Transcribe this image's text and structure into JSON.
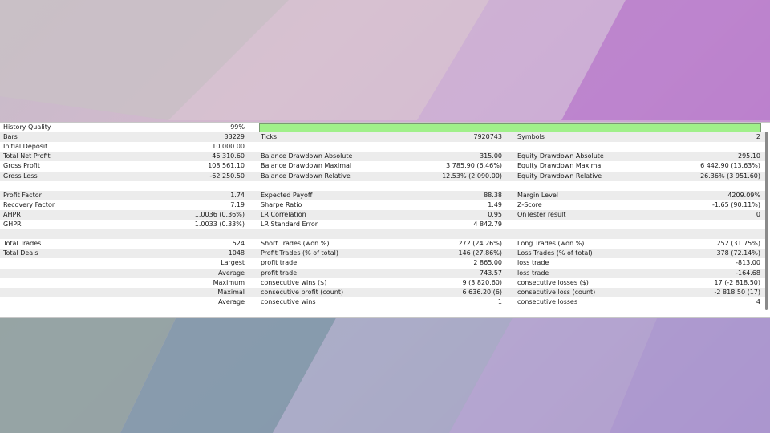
{
  "colors": {
    "quality_bar": "#a0f08a",
    "row_alt": "#ececec"
  },
  "rows": [
    {
      "c1": "History Quality",
      "v1": "99%",
      "quality_pct": 99
    },
    {
      "c1": "Bars",
      "v1": "33229",
      "c2": "Ticks",
      "v2": "7920743",
      "c3": "Symbols",
      "v3": "2"
    },
    {
      "c1": "Initial Deposit",
      "v1": "10 000.00"
    },
    {
      "c1": "Total Net Profit",
      "v1": "46 310.60",
      "c2": "Balance Drawdown Absolute",
      "v2": "315.00",
      "c3": "Equity Drawdown Absolute",
      "v3": "295.10"
    },
    {
      "c1": "Gross Profit",
      "v1": "108 561.10",
      "c2": "Balance Drawdown Maximal",
      "v2": "3 785.90 (6.46%)",
      "c3": "Equity Drawdown Maximal",
      "v3": "6 442.90 (13.63%)"
    },
    {
      "c1": "Gross Loss",
      "v1": "-62 250.50",
      "c2": "Balance Drawdown Relative",
      "v2": "12.53% (2 090.00)",
      "c3": "Equity Drawdown Relative",
      "v3": "26.36% (3 951.60)"
    },
    {},
    {
      "c1": "Profit Factor",
      "v1": "1.74",
      "c2": "Expected Payoff",
      "v2": "88.38",
      "c3": "Margin Level",
      "v3": "4209.09%"
    },
    {
      "c1": "Recovery Factor",
      "v1": "7.19",
      "c2": "Sharpe Ratio",
      "v2": "1.49",
      "c3": "Z-Score",
      "v3": "-1.65 (90.11%)"
    },
    {
      "c1": "AHPR",
      "v1": "1.0036 (0.36%)",
      "c2": "LR Correlation",
      "v2": "0.95",
      "c3": "OnTester result",
      "v3": "0"
    },
    {
      "c1": "GHPR",
      "v1": "1.0033 (0.33%)",
      "c2": "LR Standard Error",
      "v2": "4 842.79"
    },
    {},
    {
      "c1": "Total Trades",
      "v1": "524",
      "c2": "Short Trades (won %)",
      "v2": "272 (24.26%)",
      "c3": "Long Trades (won %)",
      "v3": "252 (31.75%)"
    },
    {
      "c1": "Total Deals",
      "v1": "1048",
      "c2": "Profit Trades (% of total)",
      "v2": "146 (27.86%)",
      "c3": "Loss Trades (% of total)",
      "v3": "378 (72.14%)"
    },
    {
      "v1": "Largest",
      "c2": "profit trade",
      "v2": "2 865.00",
      "c3": "loss trade",
      "v3": "-813.00"
    },
    {
      "v1": "Average",
      "c2": "profit trade",
      "v2": "743.57",
      "c3": "loss trade",
      "v3": "-164.68"
    },
    {
      "v1": "Maximum",
      "c2": "consecutive wins ($)",
      "v2": "9 (3 820.60)",
      "c3": "consecutive losses ($)",
      "v3": "17 (-2 818.50)"
    },
    {
      "v1": "Maximal",
      "c2": "consecutive profit (count)",
      "v2": "6 636.20 (6)",
      "c3": "consecutive loss (count)",
      "v3": "-2 818.50 (17)"
    },
    {
      "v1": "Average",
      "c2": "consecutive wins",
      "v2": "1",
      "c3": "consecutive losses",
      "v3": "4"
    }
  ]
}
